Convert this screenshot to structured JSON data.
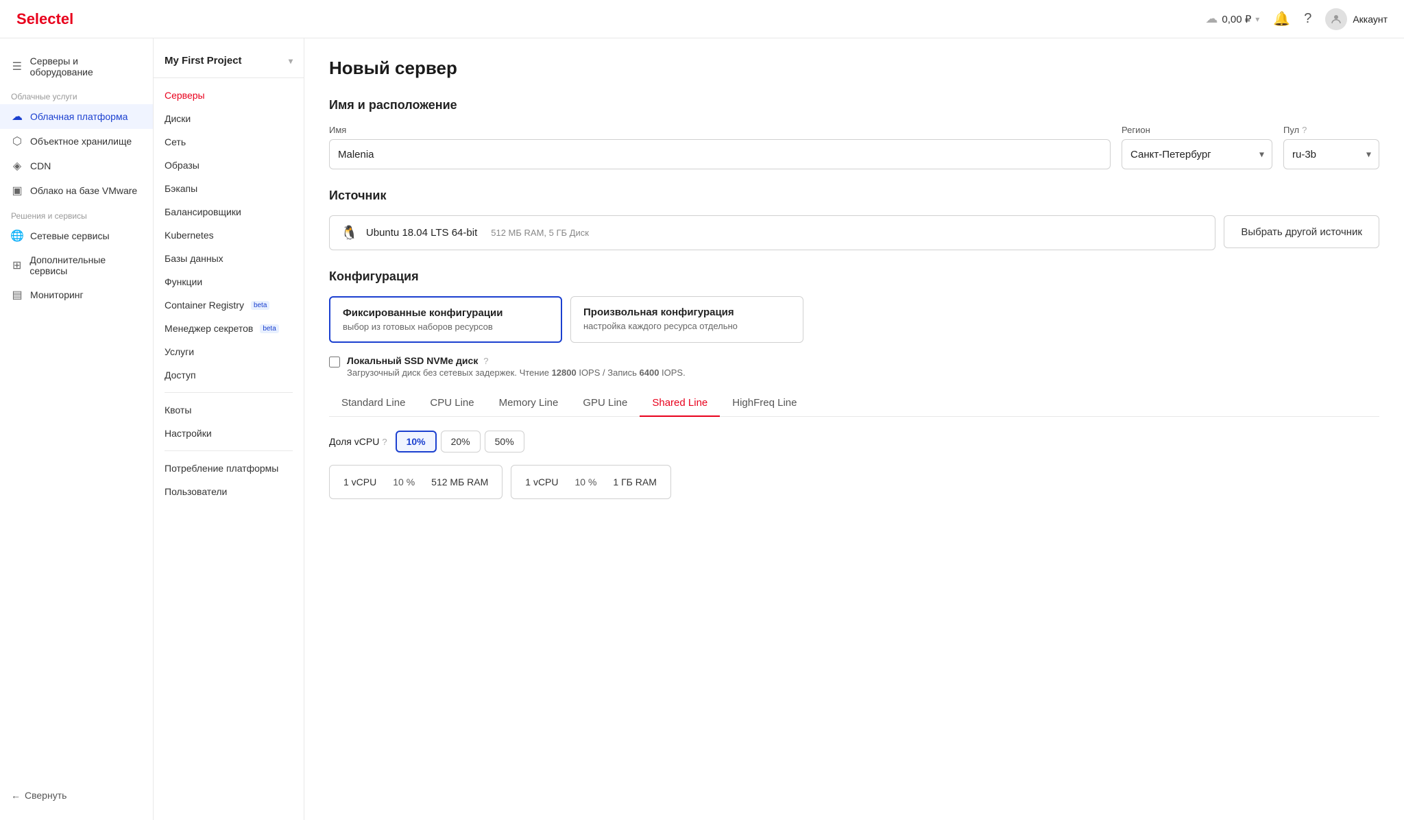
{
  "header": {
    "logo_s": "S",
    "logo_rest": "electel",
    "balance": "0,00 ₽",
    "account_label": "Аккаунт"
  },
  "sidebar_left": {
    "sections": [
      {
        "items": [
          {
            "id": "servers",
            "label": "Серверы и оборудование",
            "icon": "☰"
          }
        ]
      },
      {
        "label": "Облачные услуги",
        "items": [
          {
            "id": "cloud-platform",
            "label": "Облачная платформа",
            "icon": "☁",
            "active": true
          },
          {
            "id": "object-storage",
            "label": "Объектное хранилище",
            "icon": "⬡"
          },
          {
            "id": "cdn",
            "label": "CDN",
            "icon": "⟋"
          },
          {
            "id": "vmware",
            "label": "Облако на базе VMware",
            "icon": "▣"
          }
        ]
      },
      {
        "label": "Решения и сервисы",
        "items": [
          {
            "id": "network-services",
            "label": "Сетевые сервисы",
            "icon": "🌐"
          },
          {
            "id": "extra-services",
            "label": "Дополнительные сервисы",
            "icon": "⊞"
          },
          {
            "id": "monitoring",
            "label": "Мониторинг",
            "icon": "▤"
          }
        ]
      }
    ],
    "collapse_label": "Свернуть"
  },
  "sidebar_second": {
    "project_name": "My First Project",
    "nav_items": [
      {
        "id": "servers",
        "label": "Серверы",
        "active": true
      },
      {
        "id": "disks",
        "label": "Диски"
      },
      {
        "id": "network",
        "label": "Сеть"
      },
      {
        "id": "images",
        "label": "Образы"
      },
      {
        "id": "backups",
        "label": "Бэкапы"
      },
      {
        "id": "balancers",
        "label": "Балансировщики"
      },
      {
        "id": "kubernetes",
        "label": "Kubernetes"
      },
      {
        "id": "databases",
        "label": "Базы данных"
      },
      {
        "id": "functions",
        "label": "Функции"
      },
      {
        "id": "container-registry",
        "label": "Container Registry",
        "badge": "beta"
      },
      {
        "id": "secrets",
        "label": "Менеджер секретов",
        "badge": "beta"
      },
      {
        "id": "services",
        "label": "Услуги"
      },
      {
        "id": "access",
        "label": "Доступ"
      }
    ],
    "bottom_items": [
      {
        "id": "quotas",
        "label": "Квоты"
      },
      {
        "id": "settings",
        "label": "Настройки"
      }
    ],
    "platform_items": [
      {
        "id": "platform-usage",
        "label": "Потребление платформы"
      },
      {
        "id": "users",
        "label": "Пользователи"
      }
    ]
  },
  "main": {
    "page_title": "Новый сервер",
    "name_location_title": "Имя и расположение",
    "name_label": "Имя",
    "name_value": "Malenia",
    "region_label": "Регион",
    "region_value": "Санкт-Петербург",
    "pool_label": "Пул",
    "pool_value": "ru-3b",
    "source_title": "Источник",
    "source_name": "Ubuntu 18.04 LTS 64-bit",
    "source_meta": "512 МБ RAM, 5 ГБ Диск",
    "source_btn": "Выбрать другой источник",
    "config_title": "Конфигурация",
    "config_fixed_title": "Фиксированные конфигурации",
    "config_fixed_desc": "выбор из готовых наборов ресурсов",
    "config_custom_title": "Произвольная конфигурация",
    "config_custom_desc": "настройка каждого ресурса отдельно",
    "local_ssd_label": "Локальный SSD NVMe диск",
    "local_ssd_desc": "Загрузочный диск без сетевых задержек. Чтение ",
    "local_ssd_read": "12800",
    "local_ssd_mid": " IOPS / Запись ",
    "local_ssd_write": "6400",
    "local_ssd_end": " IOPS.",
    "tabs": [
      {
        "id": "standard",
        "label": "Standard Line"
      },
      {
        "id": "cpu",
        "label": "CPU Line"
      },
      {
        "id": "memory",
        "label": "Memory Line"
      },
      {
        "id": "gpu",
        "label": "GPU Line"
      },
      {
        "id": "shared",
        "label": "Shared Line",
        "active": true
      },
      {
        "id": "highfreq",
        "label": "HighFreq Line"
      }
    ],
    "vcpu_label": "Доля vCPU",
    "vcpu_options": [
      {
        "value": "10%",
        "selected": true
      },
      {
        "value": "20%"
      },
      {
        "value": "50%"
      }
    ],
    "config_cards": [
      {
        "vcpu": "1 vCPU",
        "percent": "10 %",
        "ram": "512 МБ RAM"
      },
      {
        "vcpu": "1 vCPU",
        "percent": "10 %",
        "ram": "1 ГБ RAM"
      }
    ]
  }
}
